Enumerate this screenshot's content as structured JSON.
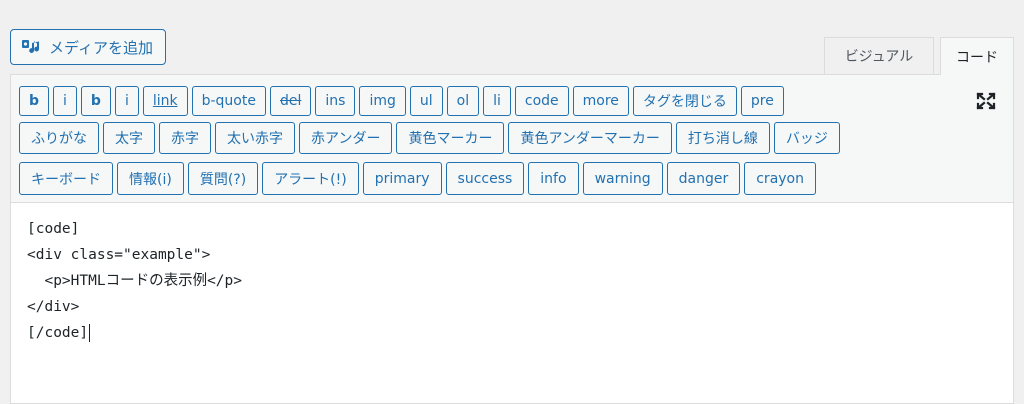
{
  "media_button": {
    "label": "メディアを追加",
    "icon": "media-icon"
  },
  "tabs": {
    "visual": "ビジュアル",
    "code": "コード"
  },
  "toolbar": {
    "row1": [
      "b",
      "i",
      "b",
      "i",
      "link",
      "b-quote",
      "del",
      "ins",
      "img",
      "ul",
      "ol",
      "li",
      "code",
      "more",
      "タグを閉じる",
      "pre"
    ],
    "row2": [
      "ふりがな",
      "太字",
      "赤字",
      "太い赤字",
      "赤アンダー",
      "黄色マーカー",
      "黄色アンダーマーカー",
      "打ち消し線",
      "バッジ"
    ],
    "row3": [
      "キーボード",
      "情報(i)",
      "質問(?)",
      "アラート(!)",
      "primary",
      "success",
      "info",
      "warning",
      "danger",
      "crayon"
    ],
    "fullscreen_icon": "fullscreen-icon"
  },
  "content": {
    "lines": [
      "[code]",
      "<div class=\"example\">",
      "  <p>HTMLコードの表示例</p>",
      "</div>",
      "[/code]"
    ]
  },
  "colors": {
    "accent": "#2271b1",
    "toolbar_bg": "#f6f7f7",
    "page_bg": "#f0f0f1"
  }
}
